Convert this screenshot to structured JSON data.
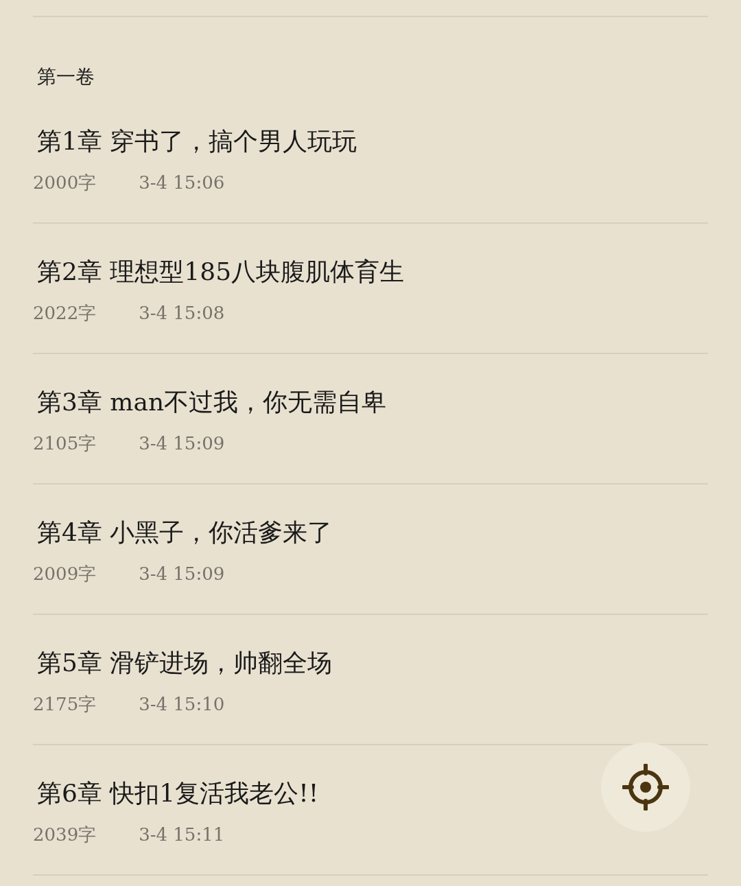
{
  "volume": {
    "title": "第一卷"
  },
  "chapters": [
    {
      "title": "第1章 穿书了，搞个男人玩玩",
      "words": "2000字",
      "time": "3-4 15:06"
    },
    {
      "title": "第2章 理想型185八块腹肌体育生",
      "words": "2022字",
      "time": "3-4 15:08"
    },
    {
      "title": "第3章 man不过我，你无需自卑",
      "words": "2105字",
      "time": "3-4 15:09"
    },
    {
      "title": "第4章 小黑子，你活爹来了",
      "words": "2009字",
      "time": "3-4 15:09"
    },
    {
      "title": "第5章 滑铲进场，帅翻全场",
      "words": "2175字",
      "time": "3-4 15:10"
    },
    {
      "title": "第6章 快扣1复活我老公!!",
      "words": "2039字",
      "time": "3-4 15:11"
    }
  ]
}
